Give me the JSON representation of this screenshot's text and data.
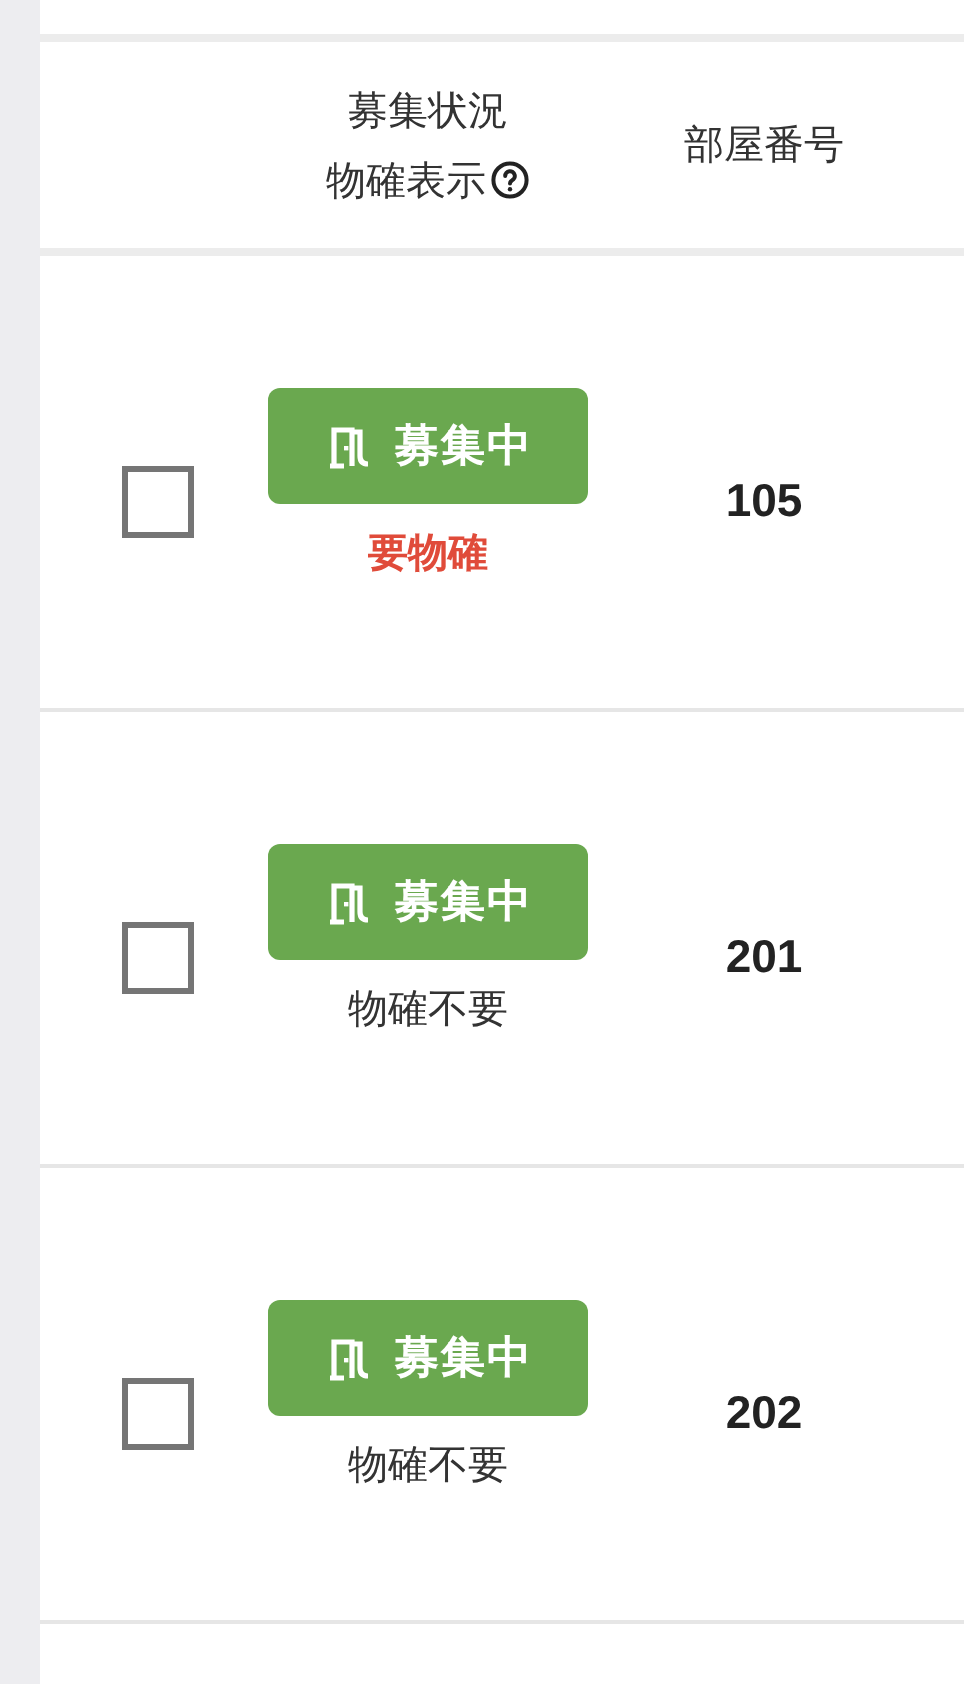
{
  "header": {
    "status_title": "募集状況",
    "confirm_title": "物確表示",
    "room_title": "部屋番号"
  },
  "rows": [
    {
      "checked": false,
      "status": "募集中",
      "note": "要物確",
      "kind": "required",
      "room": "105"
    },
    {
      "checked": false,
      "status": "募集中",
      "note": "物確不要",
      "kind": "not_required",
      "room": "201"
    },
    {
      "checked": false,
      "status": "募集中",
      "note": "物確不要",
      "kind": "not_required",
      "room": "202"
    }
  ]
}
